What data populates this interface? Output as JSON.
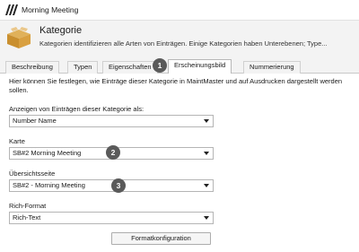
{
  "window": {
    "title": "Morning Meeting"
  },
  "header": {
    "title": "Kategorie",
    "description": "Kategorien identifizieren alle Arten von Einträgen. Einige Kategorien haben Unterebenen; Type..."
  },
  "tabs": [
    {
      "label": "Beschreibung",
      "active": false
    },
    {
      "label": "Typen",
      "active": false
    },
    {
      "label": "Eigenschaften",
      "active": false
    },
    {
      "label": "Erscheinungsbild",
      "active": true
    },
    {
      "label": "Nummerierung",
      "active": false
    }
  ],
  "content": {
    "info": "Hier können Sie festlegen, wie Einträge dieser Kategorie in MaintMaster und auf Ausdrucken dargestellt werden sollen.",
    "fields": [
      {
        "label": "Anzeigen von Einträgen dieser Kategorie als:",
        "value": "Number Name"
      },
      {
        "label": "Karte",
        "value": "SB#2 Morning Meeting"
      },
      {
        "label": "Übersichtsseite",
        "value": "SB#2 - Morning Meeting"
      },
      {
        "label": "Rich-Format",
        "value": "Rich-Text"
      }
    ],
    "format_button": "Formatkonfiguration"
  },
  "badges": [
    "1",
    "2",
    "3"
  ],
  "colors": {
    "badge": "#5a5a5a",
    "header_bg": "#f3f3f3"
  }
}
